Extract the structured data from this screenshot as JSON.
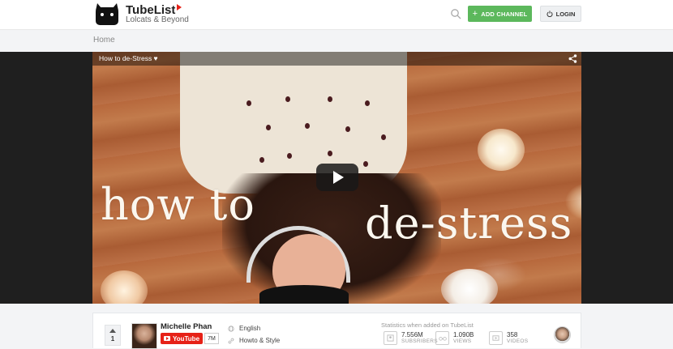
{
  "header": {
    "logo_title": "TubeList",
    "logo_subtitle": "Lolcats & Beyond",
    "add_channel_label": "ADD CHANNEL",
    "login_label": "LOGIN"
  },
  "breadcrumb": {
    "home": "Home"
  },
  "video": {
    "title": "How to de-Stress ♥",
    "overlay_line1": "how to",
    "overlay_line2": "de-stress"
  },
  "channel": {
    "vote_count": "1",
    "name": "Michelle Phan",
    "badge_label": "YouTube",
    "badge_count": "7M",
    "language": "English",
    "category": "Howto & Style"
  },
  "stats": {
    "heading": "Statistics when added on TubeList",
    "subscribers_value": "7.556M",
    "subscribers_label": "SUBSRIBERS",
    "views_value": "1.090B",
    "views_label": "VIEWS",
    "videos_value": "358",
    "videos_label": "VIDEOS"
  },
  "colors": {
    "accent_green": "#5cb85c",
    "youtube_red": "#e62117"
  }
}
